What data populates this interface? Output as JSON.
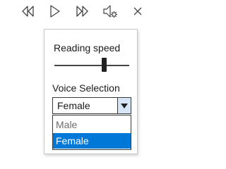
{
  "toolbar": {
    "buttons": [
      {
        "icon": "previous-icon"
      },
      {
        "icon": "play-icon"
      },
      {
        "icon": "next-icon"
      },
      {
        "icon": "voice-settings-icon"
      },
      {
        "icon": "close-icon"
      }
    ]
  },
  "settings": {
    "reading_speed_label": "Reading speed",
    "reading_speed_fraction": 0.66,
    "voice_selection_label": "Voice Selection",
    "selected_voice": "Female",
    "voice_options": [
      "Male",
      "Female"
    ],
    "highlighted_option": "Female"
  },
  "colors": {
    "accent": "#0078d7",
    "dropdown_button": "#d6e6f7"
  }
}
